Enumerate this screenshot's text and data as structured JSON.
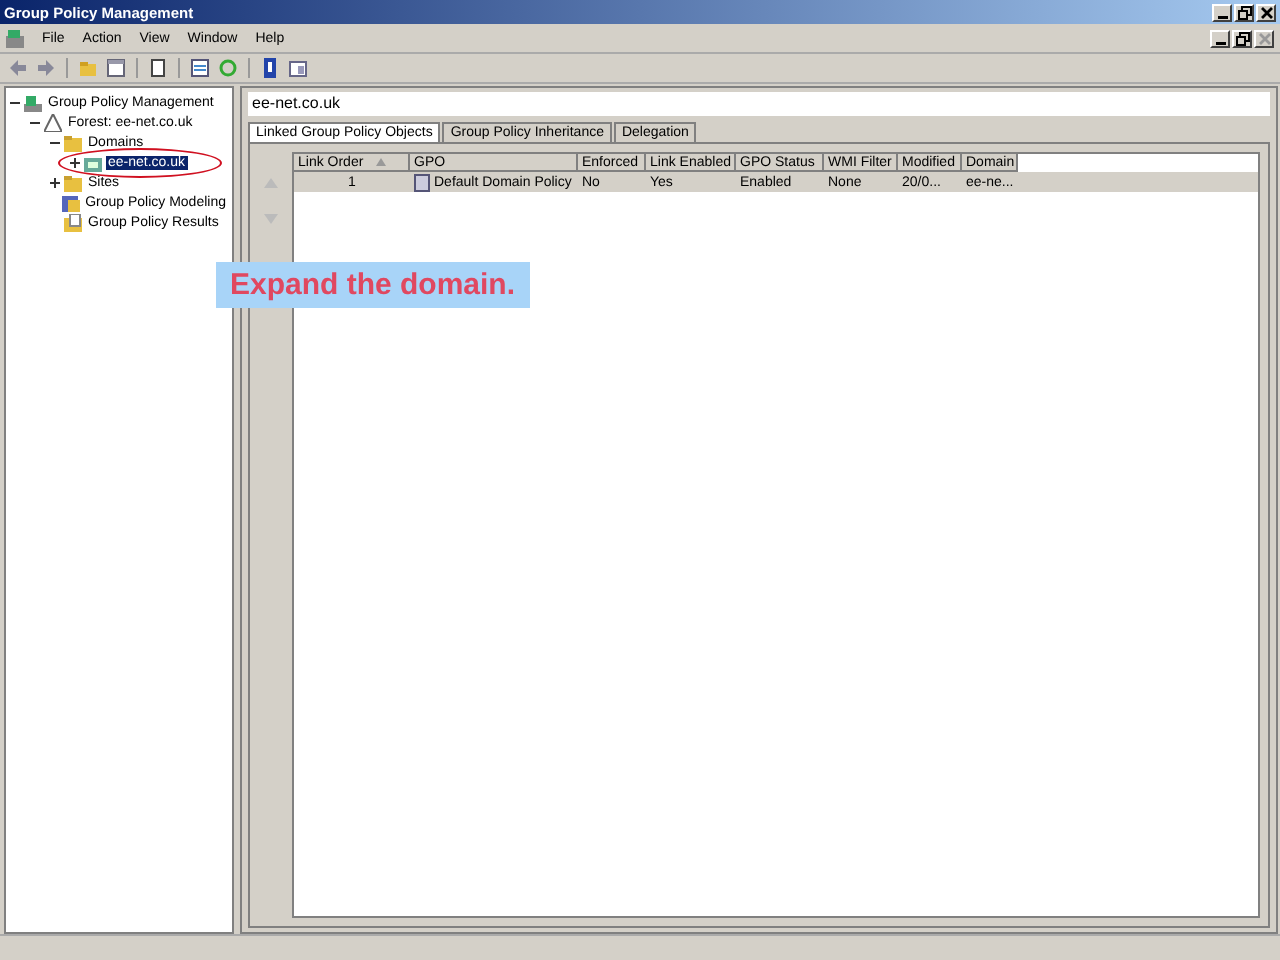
{
  "window": {
    "title": "Group Policy Management"
  },
  "menu": [
    "File",
    "Action",
    "View",
    "Window",
    "Help"
  ],
  "tree": [
    {
      "label": "Group Policy Management",
      "kind": "root",
      "expanded": true,
      "children": [
        {
          "label": "Forest: ee-net.co.uk",
          "kind": "forest",
          "expanded": true,
          "children": [
            {
              "label": "Domains",
              "kind": "folder",
              "expanded": true,
              "children": [
                {
                  "label": "ee-net.co.uk",
                  "kind": "domain",
                  "expanded": false,
                  "selected": true
                }
              ]
            },
            {
              "label": "Sites",
              "kind": "folder",
              "expanded": false,
              "selected": false
            },
            {
              "label": "Group Policy Modeling",
              "kind": "modeling",
              "selected": false
            },
            {
              "label": "Group Policy Results",
              "kind": "results",
              "selected": false
            }
          ]
        }
      ]
    }
  ],
  "panel": {
    "heading": "ee-net.co.uk",
    "tabs": [
      {
        "label": "Linked Group Policy Objects",
        "selected": true
      },
      {
        "label": "Group Policy Inheritance",
        "selected": false
      },
      {
        "label": "Delegation",
        "selected": false
      }
    ],
    "table": {
      "columns": [
        "Link Order",
        "GPO",
        "Enforced",
        "Link Enabled",
        "GPO Status",
        "WMI Filter",
        "Modified",
        "Domain"
      ],
      "rows": [
        [
          "1",
          "Default Domain Policy",
          "No",
          "Yes",
          "Enabled",
          "None",
          "20/0...",
          "ee-ne..."
        ]
      ]
    }
  },
  "callout": {
    "text": "Expand the domain."
  }
}
